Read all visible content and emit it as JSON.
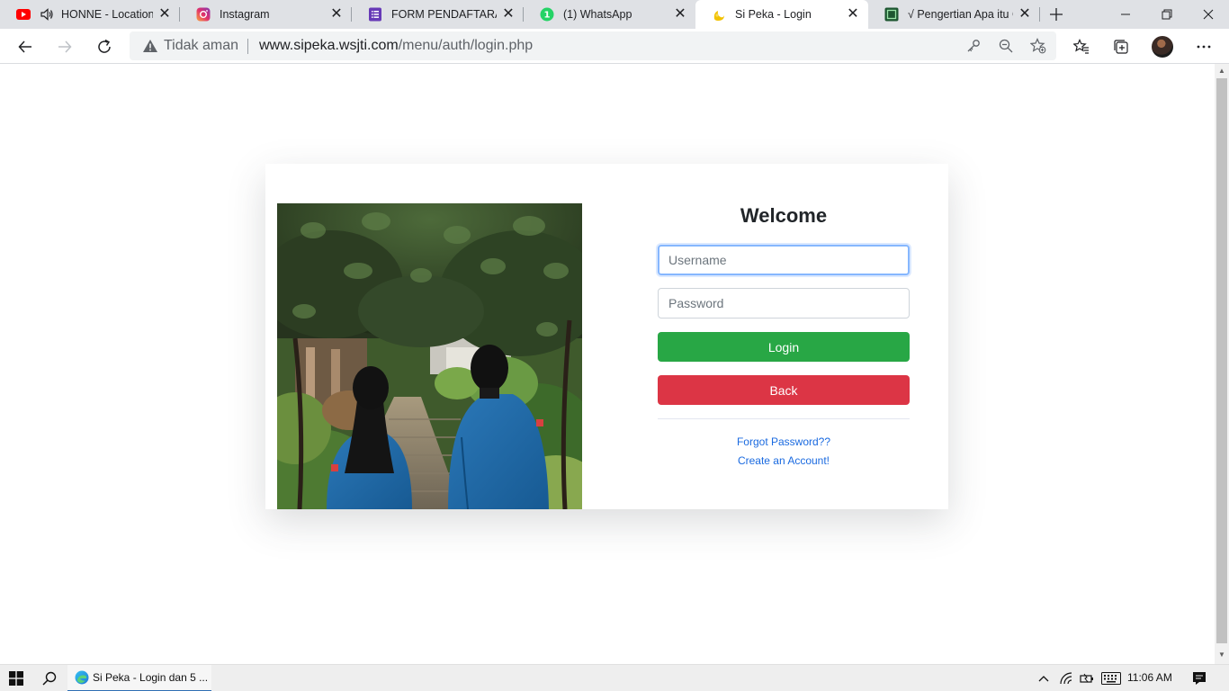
{
  "browser": {
    "tabs": [
      {
        "title": "HONNE - Location",
        "icon": "youtube-icon"
      },
      {
        "title": "Instagram",
        "icon": "instagram-icon"
      },
      {
        "title": "FORM PENDAFTARAN |",
        "icon": "google-forms-icon"
      },
      {
        "title": "(1) WhatsApp",
        "icon": "whatsapp-icon"
      },
      {
        "title": "Si Peka - Login",
        "icon": "site-favicon-icon"
      },
      {
        "title": "√ Pengertian Apa itu GU",
        "icon": "green-square-icon"
      }
    ],
    "active_tab": "Si Peka - Login",
    "security_label": "Tidak aman",
    "url_host": "www.sipeka.wsjti.com",
    "url_path": "/menu/auth/login.php"
  },
  "login": {
    "heading": "Welcome",
    "username_placeholder": "Username",
    "password_placeholder": "Password",
    "login_label": "Login",
    "back_label": "Back",
    "forgot_label": "Forgot Password??",
    "create_label": "Create an Account!"
  },
  "taskbar": {
    "app_title": "Si Peka - Login dan 5 ...",
    "clock": "11:06 AM"
  },
  "colors": {
    "login_button": "#28a745",
    "back_button": "#dc3545",
    "link": "#1a6ae0"
  }
}
